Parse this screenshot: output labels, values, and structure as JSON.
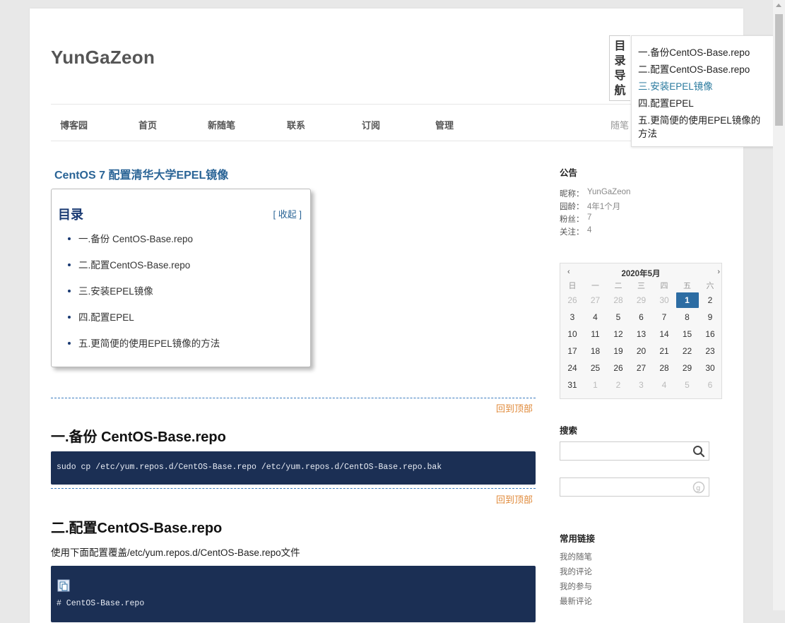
{
  "blog": {
    "title": "YunGaZeon"
  },
  "nav": {
    "items": [
      "博客园",
      "首页",
      "新随笔",
      "联系",
      "订阅",
      "管理"
    ],
    "stats_prefix": "随笔"
  },
  "post": {
    "title": "CentOS 7 配置清华大学EPEL镜像",
    "toc": {
      "heading": "目录",
      "collapse": "[ 收起 ]",
      "items": [
        "一.备份 CentOS-Base.repo",
        "二.配置CentOS-Base.repo",
        "三.安装EPEL镜像",
        "四.配置EPEL",
        "五.更简便的使用EPEL镜像的方法"
      ]
    },
    "back_to_top": "回到顶部",
    "sections": [
      {
        "heading": "一.备份 CentOS-Base.repo",
        "code": "sudo cp /etc/yum.repos.d/CentOS-Base.repo /etc/yum.repos.d/CentOS-Base.repo.bak"
      },
      {
        "heading": "二.配置CentOS-Base.repo",
        "text": "使用下面配置覆盖/etc/yum.repos.d/CentOS-Base.repo文件",
        "code": "# CentOS-Base.repo"
      }
    ]
  },
  "sidebar": {
    "notice": {
      "heading": "公告",
      "lines": [
        {
          "key": "昵称：",
          "value": "YunGaZeon"
        },
        {
          "key": "园龄：",
          "value": "4年1个月"
        },
        {
          "key": "粉丝：",
          "value": "7"
        },
        {
          "key": "关注：",
          "value": "4"
        }
      ]
    },
    "calendar": {
      "title": "2020年5月",
      "prev": "‹",
      "next": "›",
      "weekdays": [
        "日",
        "一",
        "二",
        "三",
        "四",
        "五",
        "六"
      ],
      "weeks": [
        [
          "26",
          "27",
          "28",
          "29",
          "30",
          "1",
          "2"
        ],
        [
          "3",
          "4",
          "5",
          "6",
          "7",
          "8",
          "9"
        ],
        [
          "10",
          "11",
          "12",
          "13",
          "14",
          "15",
          "16"
        ],
        [
          "17",
          "18",
          "19",
          "20",
          "21",
          "22",
          "23"
        ],
        [
          "24",
          "25",
          "26",
          "27",
          "28",
          "29",
          "30"
        ],
        [
          "31",
          "1",
          "2",
          "3",
          "4",
          "5",
          "6"
        ]
      ],
      "today": "1"
    },
    "search": {
      "heading": "搜索"
    },
    "links": {
      "heading": "常用链接",
      "items": [
        "我的随笔",
        "我的评论",
        "我的参与",
        "最新评论"
      ]
    }
  },
  "floating_toc": {
    "tab_label": [
      "目",
      "录",
      "导",
      "航"
    ],
    "items": [
      "一.备份CentOS-Base.repo",
      "二.配置CentOS-Base.repo",
      "三.安装EPEL镜像",
      "四.配置EPEL",
      "五.更简便的使用EPEL镜像的方法"
    ],
    "active_index": 2
  }
}
